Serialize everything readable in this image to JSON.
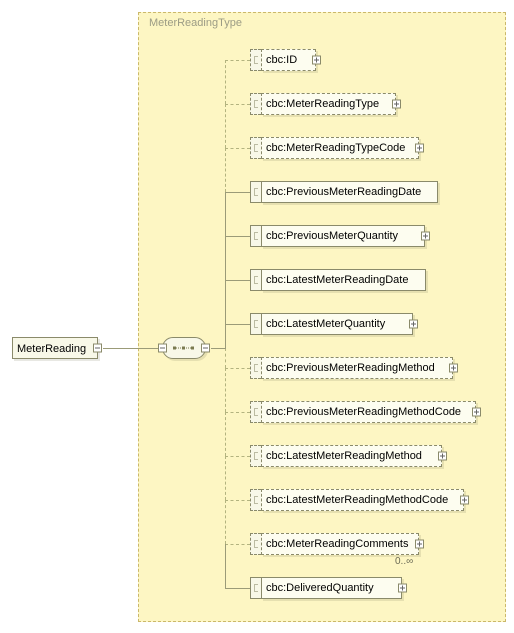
{
  "root": {
    "label": "MeterReading"
  },
  "typeContainer": {
    "title": "MeterReadingType"
  },
  "children": [
    {
      "label": "cbc:ID",
      "optional": true,
      "expandable": true,
      "multiplicity": ""
    },
    {
      "label": "cbc:MeterReadingType",
      "optional": true,
      "expandable": true,
      "multiplicity": ""
    },
    {
      "label": "cbc:MeterReadingTypeCode",
      "optional": true,
      "expandable": true,
      "multiplicity": ""
    },
    {
      "label": "cbc:PreviousMeterReadingDate",
      "optional": false,
      "expandable": false,
      "multiplicity": ""
    },
    {
      "label": "cbc:PreviousMeterQuantity",
      "optional": false,
      "expandable": true,
      "multiplicity": ""
    },
    {
      "label": "cbc:LatestMeterReadingDate",
      "optional": false,
      "expandable": false,
      "multiplicity": ""
    },
    {
      "label": "cbc:LatestMeterQuantity",
      "optional": false,
      "expandable": true,
      "multiplicity": ""
    },
    {
      "label": "cbc:PreviousMeterReadingMethod",
      "optional": true,
      "expandable": true,
      "multiplicity": ""
    },
    {
      "label": "cbc:PreviousMeterReadingMethodCode",
      "optional": true,
      "expandable": true,
      "multiplicity": ""
    },
    {
      "label": "cbc:LatestMeterReadingMethod",
      "optional": true,
      "expandable": true,
      "multiplicity": ""
    },
    {
      "label": "cbc:LatestMeterReadingMethodCode",
      "optional": true,
      "expandable": true,
      "multiplicity": ""
    },
    {
      "label": "cbc:MeterReadingComments",
      "optional": true,
      "expandable": true,
      "multiplicity": "0..∞"
    },
    {
      "label": "cbc:DeliveredQuantity",
      "optional": false,
      "expandable": true,
      "multiplicity": ""
    }
  ]
}
